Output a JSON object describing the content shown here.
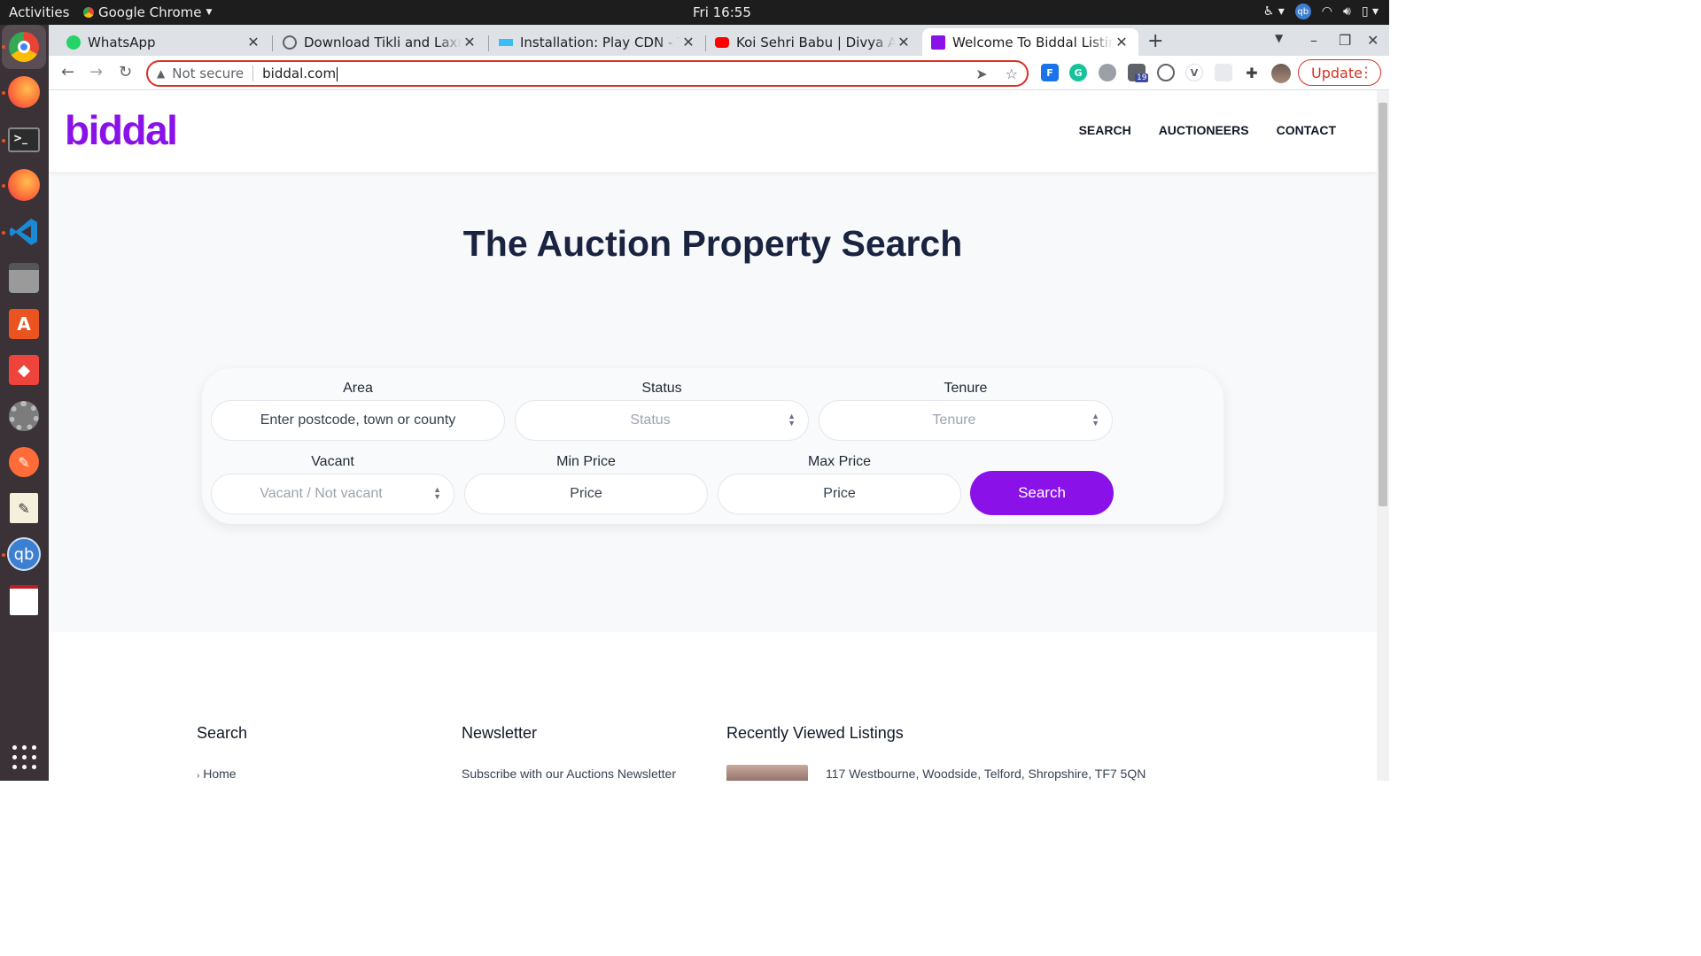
{
  "system_bar": {
    "activities": "Activities",
    "app_name": "Google Chrome",
    "clock": "Fri 16:55"
  },
  "dock": {
    "apps": [
      "chrome-icon",
      "firefox-icon",
      "terminal-icon",
      "firefox-icon",
      "vscode-icon",
      "files-icon",
      "software-center-icon",
      "anydesk-icon",
      "settings-icon",
      "postman-icon",
      "text-editor-icon",
      "qbittorrent-icon",
      "document-viewer-icon"
    ],
    "qb_label": "qb"
  },
  "tabs": [
    {
      "title": "WhatsApp",
      "favicon": "whatsapp-icon",
      "color": "#25d366"
    },
    {
      "title": "Download Tikli and Laxmi",
      "favicon": "globe-icon",
      "color": "#5f6368"
    },
    {
      "title": "Installation: Play CDN - Ta",
      "favicon": "tailwind-icon",
      "color": "#38bdf8"
    },
    {
      "title": "Koi Sehri Babu | Divya Aga",
      "favicon": "youtube-icon",
      "color": "#ff0000"
    },
    {
      "title": "Welcome To Biddal Listing",
      "favicon": "biddal-icon",
      "color": "#8a12e8"
    }
  ],
  "toolbar": {
    "security_label": "Not secure",
    "url": "biddal.com",
    "update_label": "Update",
    "ext_badge": "19"
  },
  "site": {
    "logo": "biddal",
    "brand_color": "#8a12e8",
    "nav": [
      "SEARCH",
      "AUCTIONEERS",
      "CONTACT"
    ],
    "hero_title": "The Auction Property Search",
    "form": {
      "area_label": "Area",
      "area_placeholder": "Enter postcode, town or county",
      "status_label": "Status",
      "status_value": "Status",
      "tenure_label": "Tenure",
      "tenure_value": "Tenure",
      "vacant_label": "Vacant",
      "vacant_value": "Vacant / Not vacant",
      "min_price_label": "Min Price",
      "min_price_placeholder": "Price",
      "max_price_label": "Max Price",
      "max_price_placeholder": "Price",
      "search_button": "Search"
    },
    "footer": {
      "col1_title": "Search",
      "col1_first_link": "Home",
      "col2_title": "Newsletter",
      "col2_text": "Subscribe with our Auctions Newsletter",
      "col3_title": "Recently Viewed Listings",
      "col3_item": "117 Westbourne, Woodside, Telford, Shropshire, TF7 5QN"
    }
  }
}
